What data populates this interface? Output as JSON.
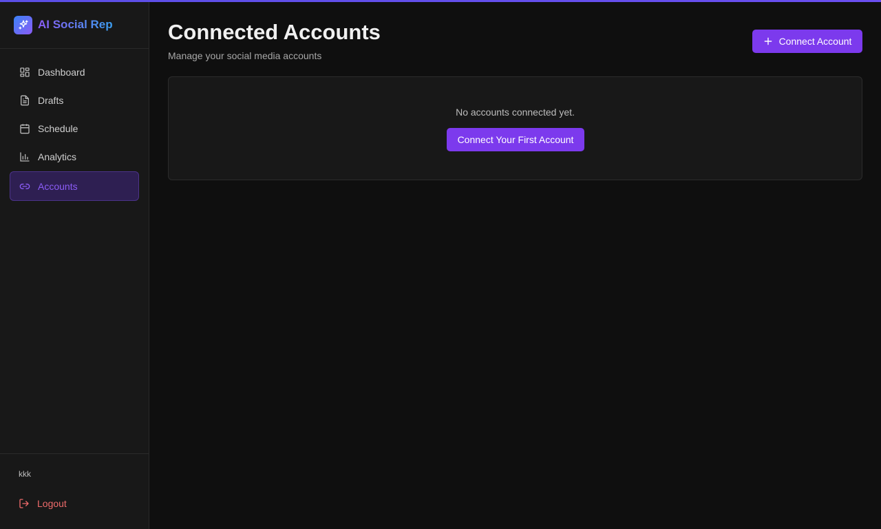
{
  "brand": {
    "name": "AI Social Rep"
  },
  "sidebar": {
    "items": [
      {
        "label": "Dashboard",
        "icon": "dashboard-icon"
      },
      {
        "label": "Drafts",
        "icon": "document-icon"
      },
      {
        "label": "Schedule",
        "icon": "calendar-icon"
      },
      {
        "label": "Analytics",
        "icon": "bar-chart-icon"
      },
      {
        "label": "Accounts",
        "icon": "link-icon",
        "active": true
      }
    ],
    "username": "kkk",
    "logout_label": "Logout"
  },
  "header": {
    "title": "Connected Accounts",
    "subtitle": "Manage your social media accounts",
    "connect_label": "Connect Account"
  },
  "empty_state": {
    "message": "No accounts connected yet.",
    "button_label": "Connect Your First Account"
  },
  "colors": {
    "accent": "#7c3aed",
    "logout": "#ef6b6b",
    "background": "#0f0f0f",
    "sidebar": "#181818"
  }
}
